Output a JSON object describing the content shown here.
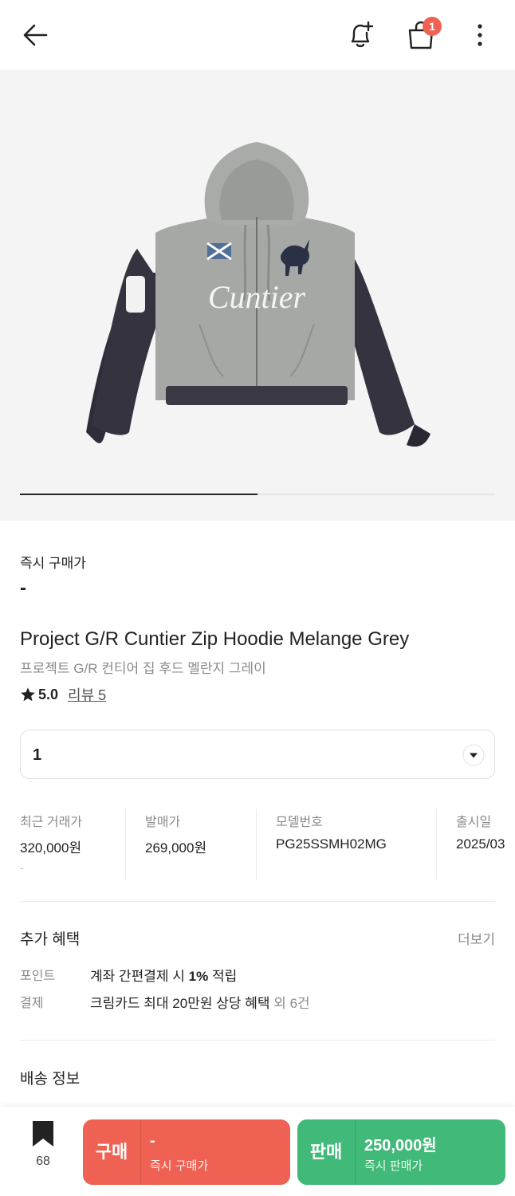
{
  "header": {
    "icons": [
      "back-arrow-icon",
      "bell-plus-icon",
      "shopping-bag-icon",
      "more-vertical-icon"
    ],
    "cart_count": "1"
  },
  "gallery": {
    "image_alt": "hoodie product photo",
    "image_lettering": "Cuntier",
    "progress": 0.5
  },
  "instant": {
    "label": "즉시 구매가",
    "price": "-"
  },
  "product": {
    "name_en": "Project G/R Cuntier Zip Hoodie Melange Grey",
    "name_ko": "프로젝트 G/R 컨티어 집 후드 멜란지 그레이",
    "rating": "5.0",
    "review": "리뷰 5"
  },
  "size_select": {
    "value": "1"
  },
  "info": [
    {
      "label": "최근 거래가",
      "value": "320,000원",
      "sub": "-"
    },
    {
      "label": "발매가",
      "value": "269,000원"
    },
    {
      "label": "모델번호",
      "value": "PG25SSMH02MG"
    },
    {
      "label": "출시일",
      "value": "2025/03"
    }
  ],
  "benefits": {
    "title": "추가 혜택",
    "more": "더보기",
    "rows": [
      {
        "key": "포인트",
        "pre": "계좌 간편결제 시 ",
        "bold": "1%",
        "post": " 적립",
        "extra": ""
      },
      {
        "key": "결제",
        "pre": "크림카드 최대 20만원 상당 혜택",
        "bold": "",
        "post": "",
        "extra": " 외 6건"
      }
    ]
  },
  "shipping": {
    "title": "배송 정보"
  },
  "bottom": {
    "wish_count": "68",
    "buy": {
      "label": "구매",
      "price": "-",
      "sub": "즉시 구매가"
    },
    "sell": {
      "label": "판매",
      "price": "250,000원",
      "sub": "즉시 판매가"
    }
  },
  "colors": {
    "buy": "#ef6253",
    "sell": "#41b979",
    "badge": "#ef6253"
  }
}
